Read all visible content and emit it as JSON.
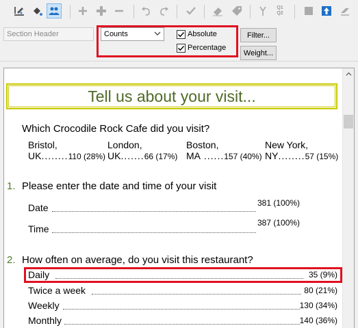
{
  "toolbar": {
    "icons": [
      "edit-pen-icon",
      "paint-bucket-icon",
      "users-icon",
      "plus-icon",
      "plus-bold-icon",
      "minus-icon",
      "undo-icon",
      "redo-icon",
      "checkmark-icon",
      "eraser-icon",
      "tag-icon",
      "branch-icon",
      "q1-q2-icon",
      "stop-icon",
      "upload-icon",
      "layers-icon"
    ],
    "q1": "Q1",
    "q2": "Q2"
  },
  "options": {
    "section_header": "Section Header",
    "display_mode": "Counts",
    "absolute_label": "Absolute",
    "absolute_checked": true,
    "percentage_label": "Percentage",
    "percentage_checked": true,
    "filter_label": "Filter...",
    "weight_label": "Weight..."
  },
  "document": {
    "title": "Tell us about your visit...",
    "q0": {
      "text": "Which Crocodile Rock Cafe did you visit?",
      "options": [
        {
          "line1": "Bristol,",
          "line2": "UK",
          "value": "110 (28%)"
        },
        {
          "line1": "London,",
          "line2": "UK",
          "value": "66 (17%)"
        },
        {
          "line1": "Boston,",
          "line2": "MA",
          "value": "157 (40%)"
        },
        {
          "line1": "New York,",
          "line2": "NY",
          "value": "57 (15%)"
        }
      ]
    },
    "q1": {
      "number": "1.",
      "text": "Please enter the date and time of your visit",
      "rows": [
        {
          "label": "Date",
          "value": "381 (100%)"
        },
        {
          "label": "Time",
          "value": "387 (100%)"
        }
      ]
    },
    "q2": {
      "number": "2.",
      "text": "How often on average, do you visit this restaurant?",
      "rows": [
        {
          "label": "Daily",
          "value": "35 (9%)"
        },
        {
          "label": "Twice a week",
          "value": "80 (21%)"
        },
        {
          "label": "Weekly",
          "value": "130 (34%)"
        },
        {
          "label": "Monthly",
          "value": "140 (36%)"
        }
      ]
    }
  },
  "colors": {
    "highlight": "#e01020",
    "title_green": "#4f6a26",
    "question_number_green": "#4f7a2a",
    "title_border": "#c8c800"
  }
}
